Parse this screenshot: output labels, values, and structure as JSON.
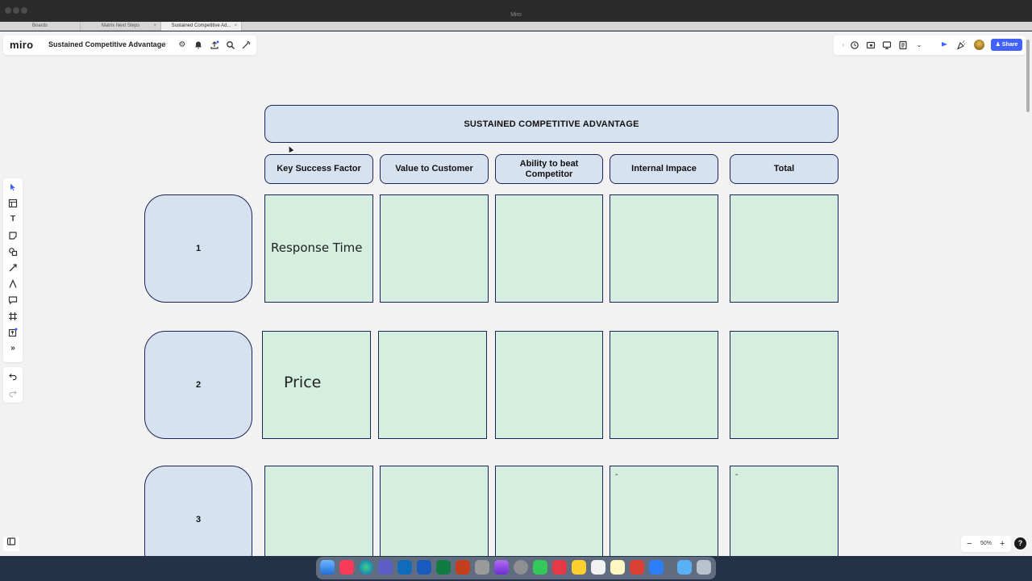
{
  "window": {
    "title": "Miro"
  },
  "tabs": [
    {
      "label": "Boards"
    },
    {
      "label": "Matrix Next Steps"
    },
    {
      "label": "Sustained Competitive Ad..."
    }
  ],
  "toolbar": {
    "logo": "miro",
    "board_name": "Sustained Competitive Advantage",
    "share_label": "Share"
  },
  "zoom": {
    "level": "50%",
    "minus": "−",
    "plus": "+"
  },
  "help": "?",
  "matrix": {
    "title": "SUSTAINED COMPETITIVE ADVANTAGE",
    "headers": [
      "Key Success Factor",
      "Value to Customer",
      "Ability to beat Competitor",
      "Internal Impace",
      "Total"
    ],
    "rows": [
      {
        "label": "1",
        "key_success_factor": "Response Time"
      },
      {
        "label": "2",
        "key_success_factor": "Price"
      },
      {
        "label": "3",
        "internal_impact": "-",
        "total": "-"
      }
    ]
  },
  "colors": {
    "header_fill": "#d7e2f1",
    "cell_fill": "#d4eedf",
    "border": "#1d2457",
    "share_button": "#4262ff"
  },
  "icons": {
    "toolbar_left": [
      "star-icon",
      "settings-icon",
      "bell-icon",
      "upload-icon",
      "search-icon",
      "magic-icon"
    ],
    "toolbar_right": [
      "chevron-right-icon",
      "timer-icon",
      "frames-icon",
      "present-icon",
      "notes-icon",
      "more-icon",
      "reactions-icon",
      "celebrate-icon"
    ],
    "left_tools": [
      "select-icon",
      "templates-icon",
      "text-icon",
      "sticky-note-icon",
      "shapes-icon",
      "pen-icon",
      "connector-icon",
      "comment-icon",
      "frame-icon",
      "upload-icon",
      "more-tools-icon"
    ],
    "history": [
      "undo-icon",
      "redo-icon"
    ]
  }
}
